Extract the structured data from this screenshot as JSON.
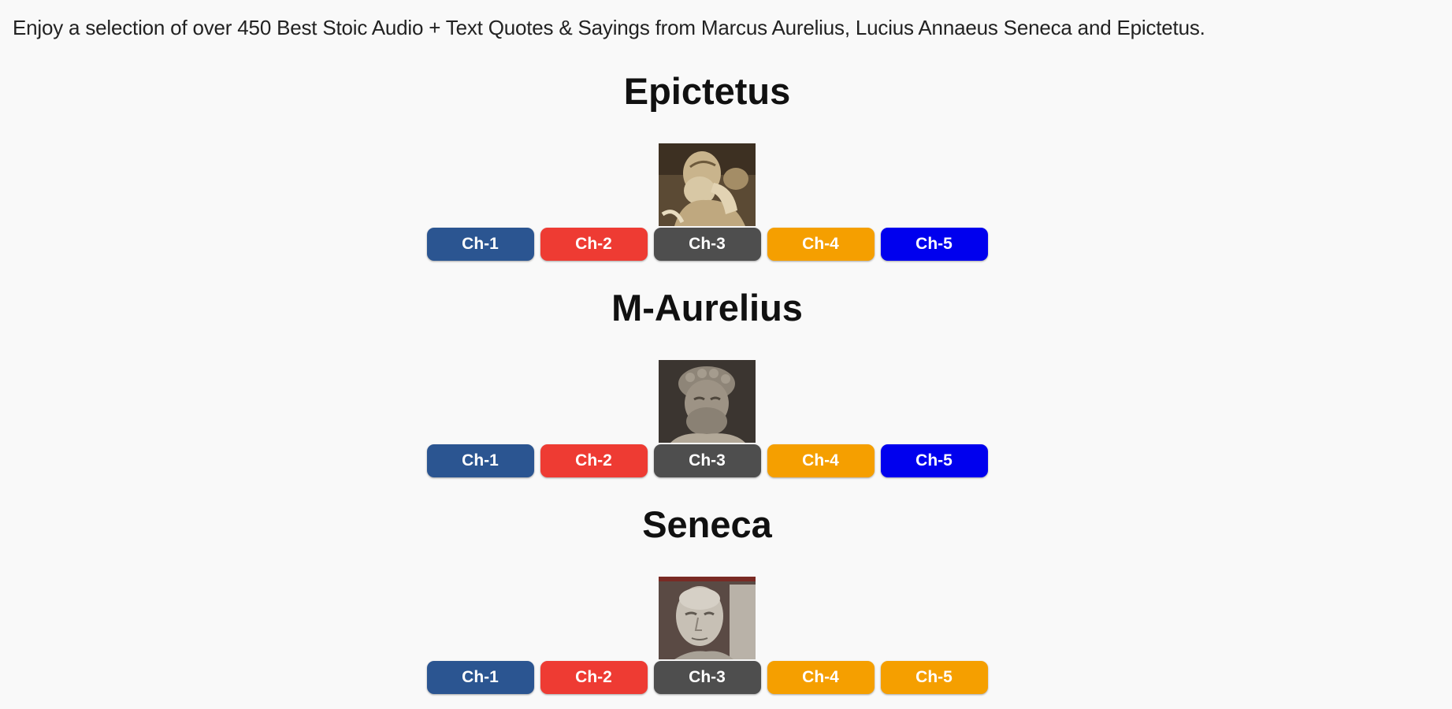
{
  "intro": "Enjoy a selection of over 450 Best Stoic Audio + Text Quotes & Sayings from Marcus Aurelius, Lucius Annaeus Seneca and Epictetus.",
  "sections": [
    {
      "title": "Epictetus",
      "portrait": "epictetus-portrait",
      "buttons": [
        {
          "label": "Ch-1",
          "color": "#2b5591"
        },
        {
          "label": "Ch-2",
          "color": "#ee3b33"
        },
        {
          "label": "Ch-3",
          "color": "#4e4e4e"
        },
        {
          "label": "Ch-4",
          "color": "#f59f00"
        },
        {
          "label": "Ch-5",
          "color": "#0000ee"
        }
      ]
    },
    {
      "title": "M-Aurelius",
      "portrait": "marcus-aurelius-portrait",
      "buttons": [
        {
          "label": "Ch-1",
          "color": "#2b5591"
        },
        {
          "label": "Ch-2",
          "color": "#ee3b33"
        },
        {
          "label": "Ch-3",
          "color": "#4e4e4e"
        },
        {
          "label": "Ch-4",
          "color": "#f59f00"
        },
        {
          "label": "Ch-5",
          "color": "#0000ee"
        }
      ]
    },
    {
      "title": "Seneca",
      "portrait": "seneca-portrait",
      "buttons": [
        {
          "label": "Ch-1",
          "color": "#2b5591"
        },
        {
          "label": "Ch-2",
          "color": "#ee3b33"
        },
        {
          "label": "Ch-3",
          "color": "#4e4e4e"
        },
        {
          "label": "Ch-4",
          "color": "#f59f00"
        },
        {
          "label": "Ch-5",
          "color": "#f59f00"
        }
      ]
    }
  ]
}
